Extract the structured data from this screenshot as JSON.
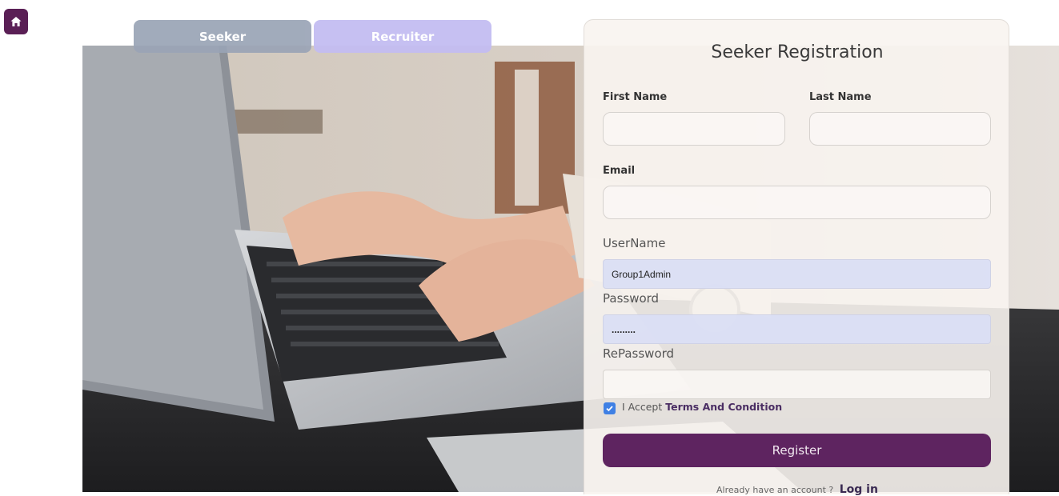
{
  "home": {
    "icon": "home-icon"
  },
  "tabs": [
    {
      "label": "Seeker"
    },
    {
      "label": "Recruiter"
    }
  ],
  "form": {
    "title": "Seeker Registration",
    "first_name": {
      "label": "First Name",
      "value": ""
    },
    "last_name": {
      "label": "Last Name",
      "value": ""
    },
    "email": {
      "label": "Email",
      "value": ""
    },
    "username": {
      "label": "UserName",
      "value": "Group1Admin"
    },
    "password": {
      "label": "Password",
      "value": "........."
    },
    "repassword": {
      "label": "RePassword",
      "value": ""
    },
    "accept": {
      "checked": true,
      "prefix": "I Accept",
      "link": "Terms And Condition"
    },
    "register_label": "Register",
    "already_text": "Already have an account ?",
    "login_label": "Log in"
  },
  "colors": {
    "brand": "#5e2460",
    "home_button": "#5a1f55",
    "checkbox": "#3f80e4",
    "tab_seeker": "#9aa4b6",
    "tab_recruiter": "#c4bdf2"
  }
}
